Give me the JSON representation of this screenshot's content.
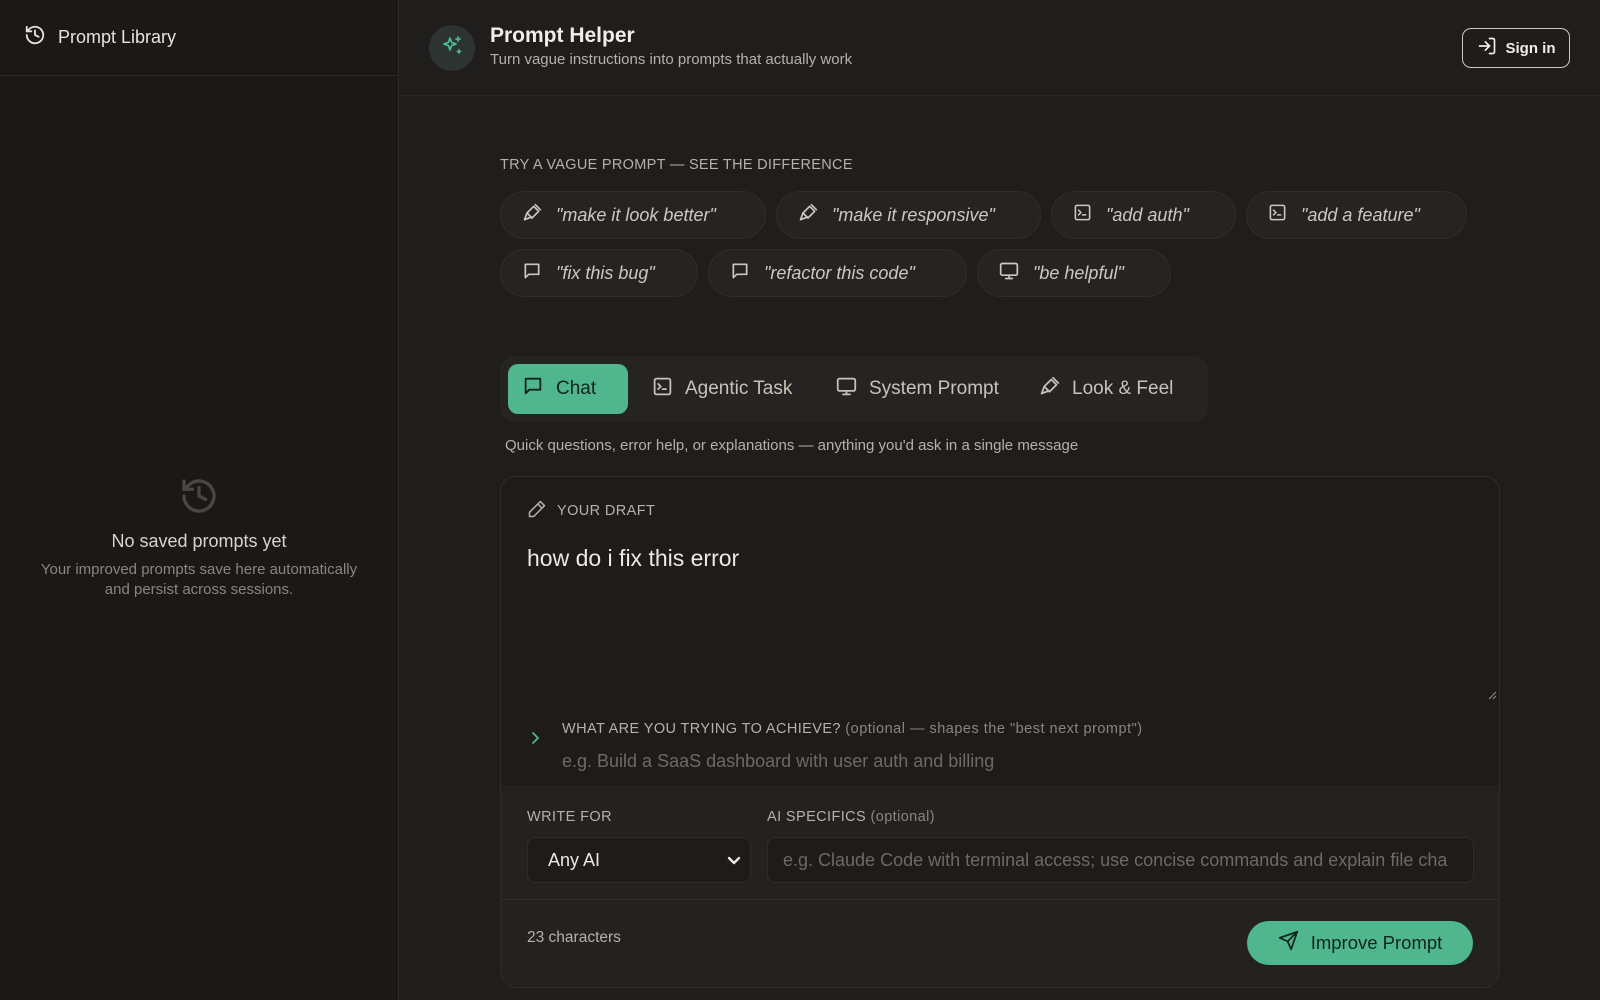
{
  "sidebar": {
    "title": "Prompt Library",
    "empty_heading": "No saved prompts yet",
    "empty_sub": "Your improved prompts save here automatically and persist across sessions."
  },
  "header": {
    "title": "Prompt Helper",
    "subtitle": "Turn vague instructions into prompts that actually work",
    "signin_label": "Sign in"
  },
  "examples": {
    "label": "TRY A VAGUE PROMPT — SEE THE DIFFERENCE",
    "chips": [
      {
        "label": "\"make it look better\"",
        "icon": "brush-icon"
      },
      {
        "label": "\"make it responsive\"",
        "icon": "brush-icon"
      },
      {
        "label": "\"add auth\"",
        "icon": "terminal-icon"
      },
      {
        "label": "\"add a feature\"",
        "icon": "terminal-icon"
      },
      {
        "label": "\"fix this bug\"",
        "icon": "chat-icon"
      },
      {
        "label": "\"refactor this code\"",
        "icon": "chat-icon"
      },
      {
        "label": "\"be helpful\"",
        "icon": "monitor-icon"
      }
    ]
  },
  "tabs": [
    {
      "label": "Chat",
      "icon": "chat-icon",
      "active": true
    },
    {
      "label": "Agentic Task",
      "icon": "terminal-icon",
      "active": false
    },
    {
      "label": "System Prompt",
      "icon": "monitor-icon",
      "active": false
    },
    {
      "label": "Look & Feel",
      "icon": "brush-icon",
      "active": false
    }
  ],
  "tab_description": "Quick questions, error help, or explanations — anything you'd ask in a single message",
  "draft": {
    "label": "YOUR DRAFT",
    "text": "how do i fix this error"
  },
  "goal": {
    "label": "WHAT ARE YOU TRYING TO ACHIEVE?",
    "optional_note": "(optional — shapes the \"best next prompt\")",
    "placeholder": "e.g. Build a SaaS dashboard with user auth and billing"
  },
  "write_for": {
    "label": "WRITE FOR",
    "selected": "Any AI"
  },
  "ai_specifics": {
    "label": "AI SPECIFICS",
    "optional_note": "(optional)",
    "placeholder": "e.g. Claude Code with terminal access; use concise commands and explain file cha"
  },
  "footer": {
    "char_count": "23 characters",
    "improve_label": "Improve Prompt"
  },
  "colors": {
    "accent": "#4fb68e",
    "background": "#201e1c",
    "sidebar": "#1a1918"
  }
}
